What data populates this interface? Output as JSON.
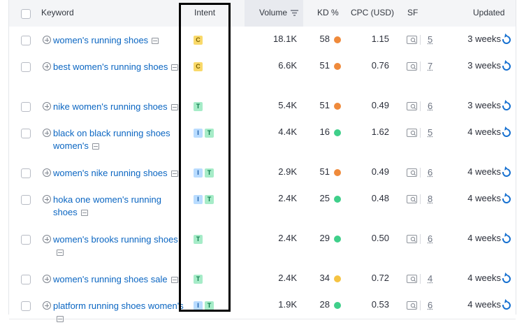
{
  "header": {
    "keyword": "Keyword",
    "intent": "Intent",
    "volume": "Volume",
    "kd": "KD %",
    "cpc": "CPC (USD)",
    "sf": "SF",
    "updated": "Updated"
  },
  "rows": [
    {
      "keyword": "women's running shoes",
      "intent": [
        "C"
      ],
      "volume": "18.1K",
      "kd": "58",
      "kd_color": "#ef8a3b",
      "cpc": "1.15",
      "sf": "5",
      "updated": "3 weeks"
    },
    {
      "keyword": "best women's running shoes",
      "intent": [
        "C"
      ],
      "volume": "6.6K",
      "kd": "51",
      "kd_color": "#ef8a3b",
      "cpc": "0.76",
      "sf": "7",
      "updated": "3 weeks"
    },
    {
      "keyword": "nike women's running shoes",
      "intent": [
        "T"
      ],
      "volume": "5.4K",
      "kd": "51",
      "kd_color": "#ef8a3b",
      "cpc": "0.49",
      "sf": "6",
      "updated": "3 weeks"
    },
    {
      "keyword": "black on black running shoes women's",
      "intent": [
        "I",
        "T"
      ],
      "volume": "4.4K",
      "kd": "16",
      "kd_color": "#3fcf8a",
      "cpc": "1.62",
      "sf": "5",
      "updated": "4 weeks"
    },
    {
      "keyword": "women's nike running shoes",
      "intent": [
        "I",
        "T"
      ],
      "volume": "2.9K",
      "kd": "51",
      "kd_color": "#ef8a3b",
      "cpc": "0.49",
      "sf": "6",
      "updated": "4 weeks"
    },
    {
      "keyword": "hoka one women's running shoes",
      "intent": [
        "I",
        "T"
      ],
      "volume": "2.4K",
      "kd": "25",
      "kd_color": "#3fcf8a",
      "cpc": "0.48",
      "sf": "8",
      "updated": "4 weeks"
    },
    {
      "keyword": "women's brooks running shoes",
      "intent": [
        "T"
      ],
      "volume": "2.4K",
      "kd": "29",
      "kd_color": "#3fcf8a",
      "cpc": "0.50",
      "sf": "6",
      "updated": "4 weeks"
    },
    {
      "keyword": "women's running shoes sale",
      "intent": [
        "T"
      ],
      "volume": "2.4K",
      "kd": "34",
      "kd_color": "#f5c342",
      "cpc": "0.72",
      "sf": "4",
      "updated": "4 weeks"
    },
    {
      "keyword": "platform running shoes women's",
      "intent": [
        "I",
        "T"
      ],
      "volume": "1.9K",
      "kd": "28",
      "kd_color": "#3fcf8a",
      "cpc": "0.53",
      "sf": "6",
      "updated": "4 weeks"
    }
  ]
}
